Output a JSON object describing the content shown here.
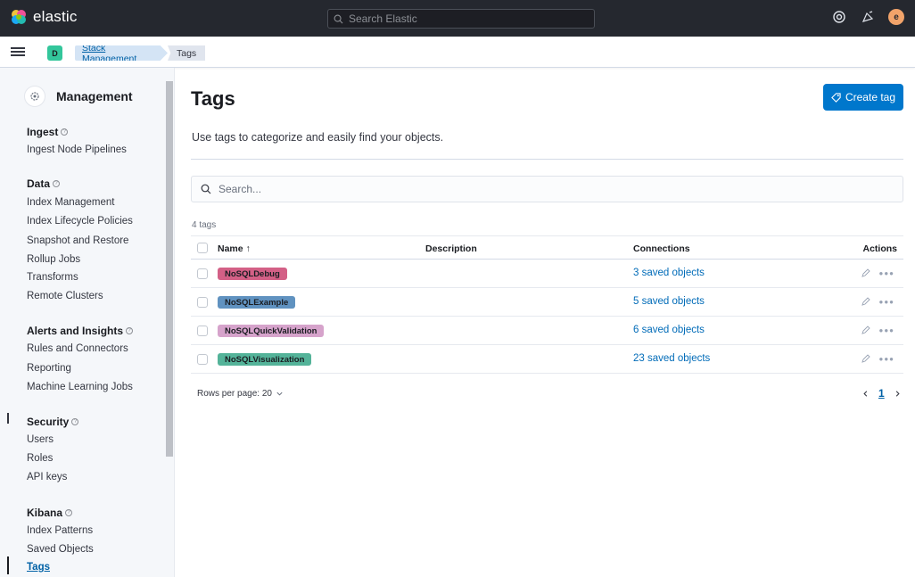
{
  "header": {
    "brand": "elastic",
    "search_placeholder": "Search Elastic",
    "avatar_letter": "e"
  },
  "breadcrumbs": {
    "space_letter": "D",
    "items": [
      "Stack Management",
      "Tags"
    ]
  },
  "sidebar": {
    "title": "Management",
    "groups": [
      {
        "title": "Ingest",
        "items": [
          "Ingest Node Pipelines"
        ]
      },
      {
        "title": "Data",
        "items": [
          "Index Management",
          "Index Lifecycle Policies",
          "Snapshot and Restore",
          "Rollup Jobs",
          "Transforms",
          "Remote Clusters"
        ]
      },
      {
        "title": "Alerts and Insights",
        "items": [
          "Rules and Connectors",
          "Reporting",
          "Machine Learning Jobs"
        ]
      },
      {
        "title": "Security",
        "items": [
          "Users",
          "Roles",
          "API keys"
        ]
      },
      {
        "title": "Kibana",
        "items": [
          "Index Patterns",
          "Saved Objects",
          "Tags"
        ]
      }
    ],
    "active_item": "Tags"
  },
  "main": {
    "title": "Tags",
    "create_button": "Create tag",
    "subtitle": "Use tags to categorize and easily find your objects.",
    "search_placeholder": "Search...",
    "count_label": "4 tags",
    "columns": {
      "name": "Name ↑",
      "description": "Description",
      "connections": "Connections",
      "actions": "Actions"
    },
    "rows": [
      {
        "name": "NoSQLDebug",
        "color": "#d36086",
        "description": "",
        "connections": "3 saved objects"
      },
      {
        "name": "NoSQLExample",
        "color": "#6092c0",
        "description": "",
        "connections": "5 saved objects"
      },
      {
        "name": "NoSQLQuickValidation",
        "color": "#d6a3cb",
        "description": "",
        "connections": "6 saved objects"
      },
      {
        "name": "NoSQLVisualization",
        "color": "#54b399",
        "description": "",
        "connections": "23 saved objects"
      }
    ],
    "rows_per_page": "Rows per page: 20",
    "current_page": "1"
  },
  "colors": {
    "header_bg": "#25282f",
    "primary": "#0077cc",
    "link": "#006bb8"
  }
}
